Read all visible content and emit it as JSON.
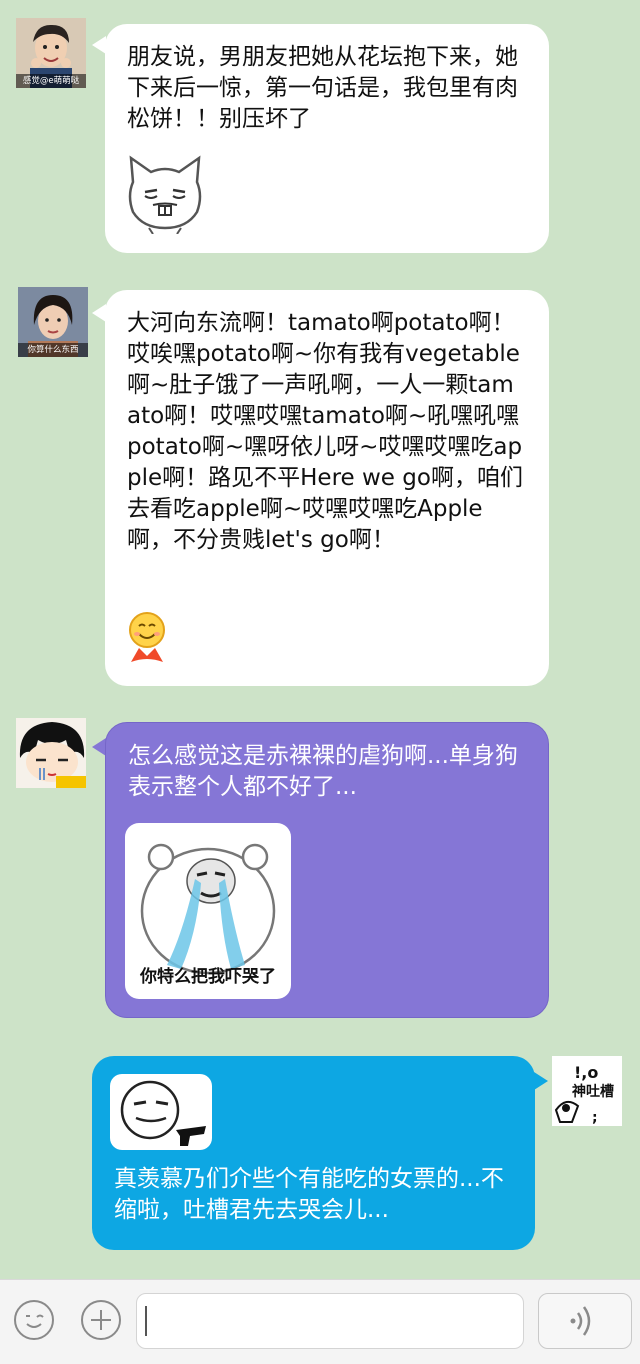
{
  "messages": [
    {
      "side": "left",
      "avatar_caption": "感觉@e萌萌哒",
      "text": "朋友说，男朋友把她从花坛抱下来，她下来后一惊，第一句话是，我包里有肉松饼！！别压坏了",
      "sticker": "smirking-cat-sticker"
    },
    {
      "side": "left",
      "avatar_caption": "你算什么东西",
      "text": "大河向东流啊！tamato啊potato啊！哎唉嘿potato啊~你有我有vegetable啊~肚子饿了一声吼啊，一人一颗tamato啊！哎嘿哎嘿tamato啊~吼嘿吼嘿potato啊~嘿呀依儿呀~哎嘿哎嘿吃apple啊！路见不平Here we go啊，咱们去看吃apple啊~哎嘿哎嘿吃Apple啊，不分贵贱let's go啊！",
      "sticker": "penguin-smiley-emoji"
    },
    {
      "side": "left",
      "text": "怎么感觉这是赤裸裸的虐狗啊...单身狗表示整个人都不好了...",
      "sticker_caption": "你特么把我吓哭了"
    },
    {
      "side": "right",
      "avatar_caption_top": "!,o",
      "avatar_caption": "神吐槽",
      "text": "真羡慕乃们介些个有能吃的女票的...不缩啦，吐槽君先去哭会儿...",
      "sticker": "smug-face-gun-sticker"
    }
  ],
  "input_bar": {
    "emoji_icon": "emoji-icon",
    "plus_icon": "plus-icon",
    "voice_icon": "voice-icon",
    "message_value": ""
  },
  "colors": {
    "background": "#cde3c8",
    "bubble_white": "#ffffff",
    "bubble_purple": "#8576d6",
    "bubble_blue": "#0da7e3"
  }
}
